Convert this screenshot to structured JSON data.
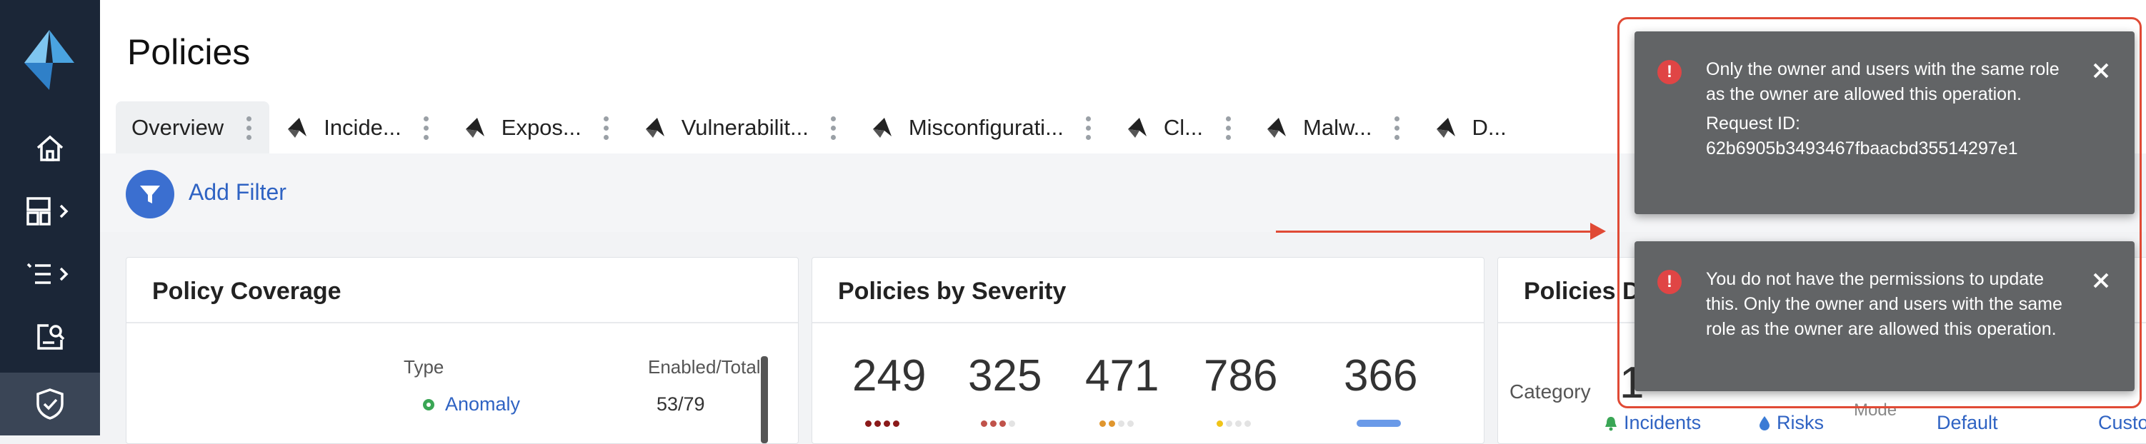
{
  "colors": {
    "sidebar_bg": "#1b2637",
    "accent_blue": "#2f63c3",
    "notification_bg": "#626466",
    "error_red": "#e04545",
    "highlight_red": "#e04a35"
  },
  "sidebar": {
    "items": [
      {
        "icon": "home-icon"
      },
      {
        "icon": "dashboards-icon"
      },
      {
        "icon": "list-icon"
      },
      {
        "icon": "search-report-icon"
      },
      {
        "icon": "shield-check-icon",
        "active": true
      }
    ]
  },
  "header": {
    "title": "Policies"
  },
  "tabs": [
    {
      "label": "Overview",
      "active": true
    },
    {
      "label": "Incide..."
    },
    {
      "label": "Expos..."
    },
    {
      "label": "Vulnerabilit..."
    },
    {
      "label": "Misconfigurati..."
    },
    {
      "label": "Cl..."
    },
    {
      "label": "Malw..."
    },
    {
      "label": "D..."
    }
  ],
  "filter": {
    "label": "Add Filter"
  },
  "coverage": {
    "title": "Policy Coverage",
    "col_type": "Type",
    "col_enabled": "Enabled/Total",
    "row_name": "Anomaly",
    "row_value": "53/79"
  },
  "severity": {
    "title": "Policies by Severity",
    "values": [
      "249",
      "325",
      "471",
      "786",
      "366"
    ]
  },
  "category": {
    "title": "Policies D",
    "label": "Category",
    "big_value": "1",
    "mode_label": "Mode",
    "links": [
      "Incidents",
      "Risks",
      "Default",
      "Custom"
    ]
  },
  "notifications": [
    {
      "message": "Only the owner and users with the same role as the owner are allowed this operation.",
      "request_label": "Request ID:",
      "request_id": "62b6905b3493467fbaacbd35514297e1"
    },
    {
      "message": "You do not have the permissions to update this. Only the owner and users with the same role as the owner are allowed this operation."
    }
  ]
}
